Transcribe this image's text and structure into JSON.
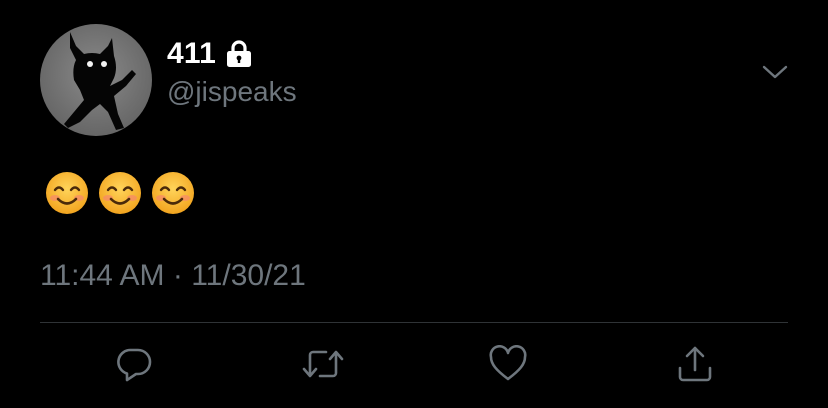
{
  "tweet": {
    "display_name": "411",
    "handle": "@jispeaks",
    "body_emojis": [
      "smiling-face-with-smiling-eyes",
      "smiling-face-with-smiling-eyes",
      "smiling-face-with-smiling-eyes"
    ],
    "time": "11:44 AM",
    "separator": "·",
    "date": "11/30/21"
  },
  "icons": {
    "lock": "lock-icon",
    "caret": "chevron-down-icon",
    "reply": "reply-icon",
    "retweet": "retweet-icon",
    "like": "heart-icon",
    "share": "share-icon"
  },
  "colors": {
    "background": "#000000",
    "primary_text": "#ffffff",
    "secondary_text": "#6e767d",
    "divider": "#2f3336"
  }
}
